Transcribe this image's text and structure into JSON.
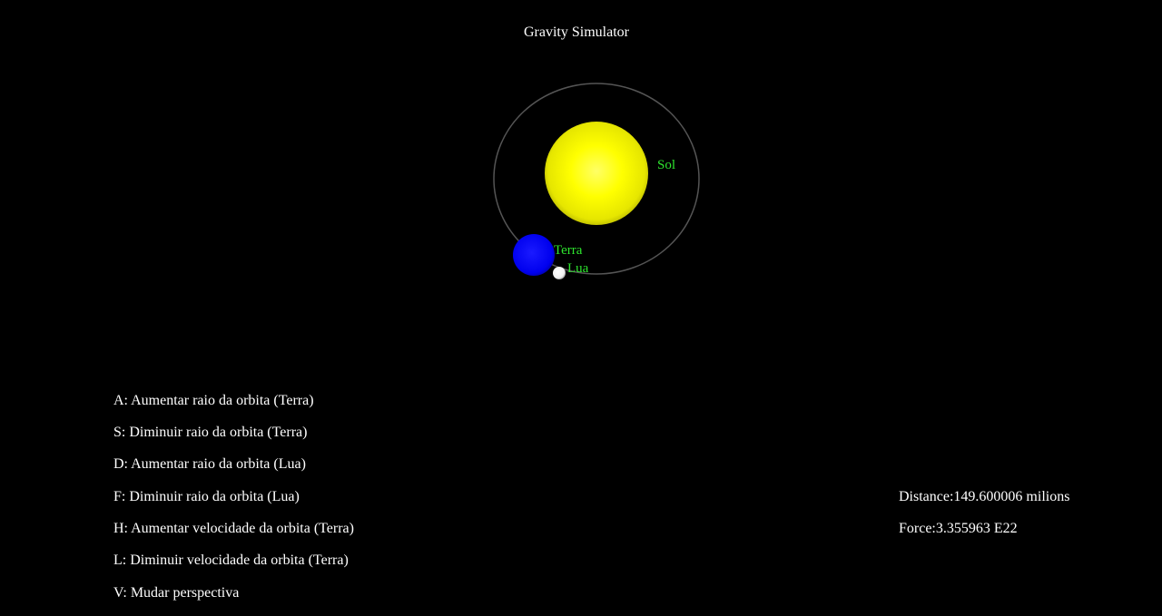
{
  "window": {
    "title": "Gravity Simulator",
    "background": "#000000"
  },
  "bodies": {
    "sun": {
      "label": "Sol",
      "color": "#ffff00"
    },
    "earth": {
      "label": "Terra",
      "color": "#0000ff"
    },
    "moon": {
      "label": "Lua",
      "color": "#ffffff"
    },
    "label_color": "#2ee62e",
    "orbit_color": "#555555"
  },
  "controls": [
    {
      "text": "A: Aumentar raio da orbita (Terra)"
    },
    {
      "text": "S: Diminuir raio da orbita (Terra)"
    },
    {
      "text": "D: Aumentar raio da orbita (Lua)"
    },
    {
      "text": "F: Diminuir raio da orbita (Lua)"
    },
    {
      "text": "H: Aumentar velocidade da orbita (Terra)"
    },
    {
      "text": "L: Diminuir velocidade da orbita (Terra)"
    },
    {
      "text": "V: Mudar perspectiva"
    }
  ],
  "stats": {
    "distance": "Distance:149.600006 milions",
    "force": "Force:3.355963 E22"
  }
}
